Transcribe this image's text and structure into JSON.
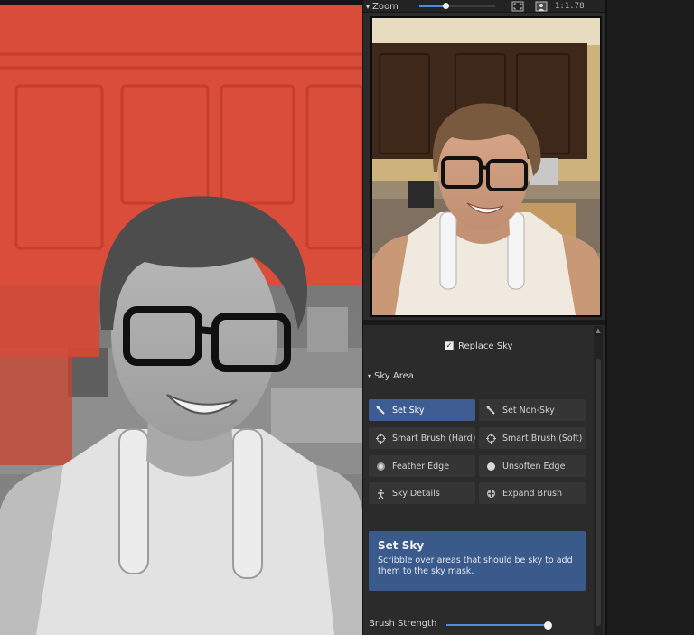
{
  "zoom": {
    "label": "Zoom",
    "slider_value": 0.35,
    "ratio_text": "1:1.78",
    "fit_icon": "fit-to-screen-icon",
    "person_icon": "person-icon"
  },
  "options": {
    "replace_sky_label": "Replace Sky",
    "replace_sky_checked": true
  },
  "sky_area": {
    "header": "Sky Area",
    "tools": [
      {
        "label": "Set Sky",
        "icon": "brush-icon",
        "active": true
      },
      {
        "label": "Set Non-Sky",
        "icon": "brush-icon",
        "active": false
      },
      {
        "label": "Smart Brush (Hard)",
        "icon": "crosshair-icon",
        "active": false
      },
      {
        "label": "Smart Brush (Soft)",
        "icon": "crosshair-icon",
        "active": false
      },
      {
        "label": "Feather Edge",
        "icon": "feather-dot-icon",
        "active": false
      },
      {
        "label": "Unsoften Edge",
        "icon": "solid-dot-icon",
        "active": false
      },
      {
        "label": "Sky Details",
        "icon": "sky-details-icon",
        "active": false
      },
      {
        "label": "Expand Brush",
        "icon": "expand-icon",
        "active": false
      }
    ]
  },
  "info": {
    "title": "Set Sky",
    "text": "Scribble over areas that should be sky to add them to the sky mask."
  },
  "brush": {
    "label": "Brush Strength",
    "value": 1.0
  },
  "colors": {
    "accent": "#4a8ee0",
    "active_button": "#3d5d92",
    "info_box": "#3b5a8c",
    "sky_mask_overlay": "#e34d3a"
  }
}
